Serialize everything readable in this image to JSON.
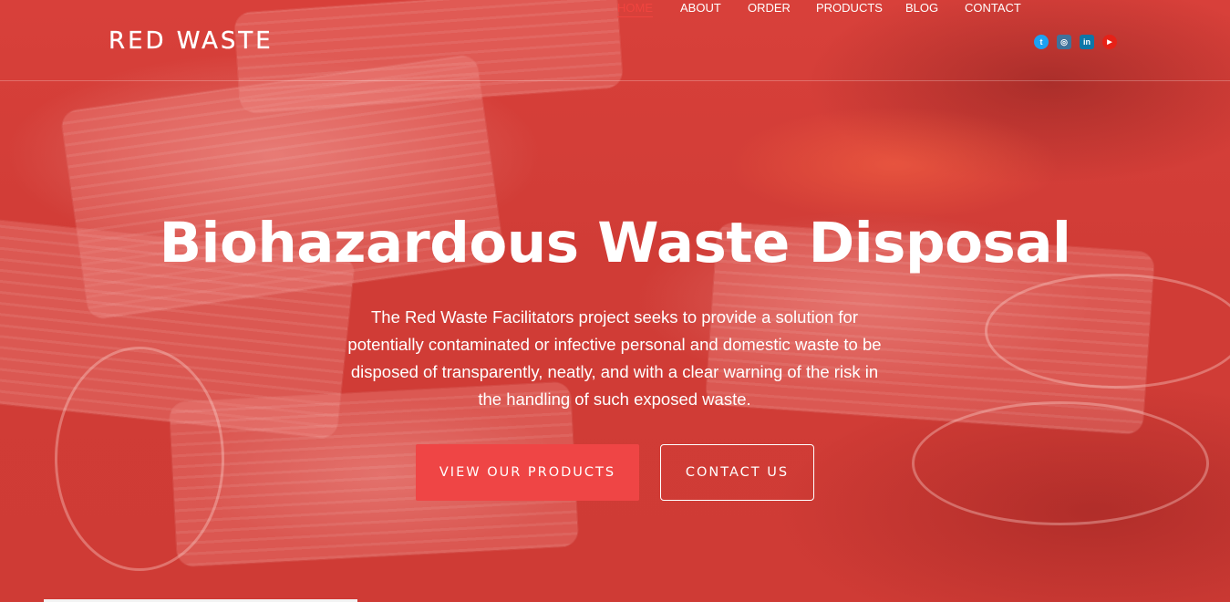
{
  "brand": {
    "logo_text": "RED WASTE"
  },
  "nav": {
    "items": [
      {
        "label": "HOME",
        "active": true
      },
      {
        "label": "ABOUT",
        "active": false
      },
      {
        "label": "ORDER",
        "active": false
      },
      {
        "label": "PRODUCTS",
        "active": false
      },
      {
        "label": "BLOG",
        "active": false
      },
      {
        "label": "CONTACT",
        "active": false
      }
    ],
    "social": [
      {
        "icon": "twitter-icon",
        "glyph": "t",
        "color": "#1da1f2"
      },
      {
        "icon": "instagram-icon",
        "glyph": "◎",
        "color": "#3f729b"
      },
      {
        "icon": "linkedin-icon",
        "glyph": "in",
        "color": "#0e76a8"
      },
      {
        "icon": "youtube-icon",
        "glyph": "▶",
        "color": "#e62117"
      }
    ]
  },
  "hero": {
    "title": "Biohazardous Waste Disposal",
    "description": "The Red Waste Facilitators project seeks to provide a solution for potentially contaminated or infective personal and domestic waste to be disposed of transparently, neatly, and with a clear warning of the risk in the handling of such exposed waste.",
    "primary_button": "VIEW OUR PRODUCTS",
    "secondary_button": "CONTACT US"
  },
  "colors": {
    "accent": "#ef4545",
    "overlay": "#d03c36",
    "text": "#ffffff"
  }
}
